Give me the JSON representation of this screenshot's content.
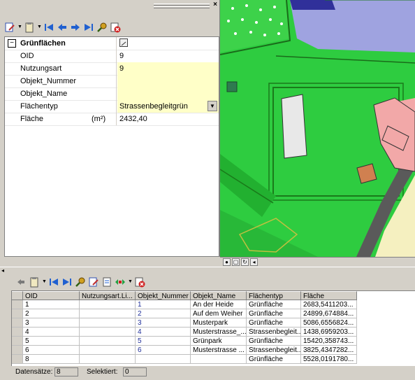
{
  "attributes": {
    "group": "Grünflächen",
    "rows": [
      {
        "label": "OID",
        "value": "9"
      },
      {
        "label": "Nutzungsart",
        "value": "9"
      },
      {
        "label": "Objekt_Nummer",
        "value": ""
      },
      {
        "label": "Objekt_Name",
        "value": ""
      },
      {
        "label": "Flächentyp",
        "value": "Strassenbegleitgrün"
      },
      {
        "label": "Fläche",
        "unit": "(m²)",
        "value": "2432,40"
      }
    ]
  },
  "table": {
    "headers": [
      "OID",
      "Nutzungsart.Li...",
      "Objekt_Nummer",
      "Objekt_Name",
      "Flächentyp",
      "Fläche"
    ],
    "rows": [
      [
        "1",
        "",
        "1",
        "An der Heide",
        "Grünfläche",
        "2683,5411203..."
      ],
      [
        "2",
        "",
        "2",
        "Auf dem Weiher",
        "Grünfläche",
        "24899,674884..."
      ],
      [
        "3",
        "",
        "3",
        "Musterpark",
        "Grünfläche",
        "5086,6556824..."
      ],
      [
        "4",
        "",
        "4",
        "Musterstrasse_...",
        "Strassenbegleit...",
        "1438,6959203..."
      ],
      [
        "5",
        "",
        "5",
        "Grünpark",
        "Grünfläche",
        "15420,358743..."
      ],
      [
        "6",
        "",
        "6",
        "Musterstrasse ...",
        "Strassenbegleit...",
        "3825,4347282..."
      ],
      [
        "8",
        "",
        "",
        "",
        "Grünfläche",
        "5528,0191780..."
      ]
    ]
  },
  "status": {
    "records_label": "Datensätze:",
    "records_value": "8",
    "selected_label": "Selektiert:",
    "selected_value": "0"
  },
  "icons": {
    "close": "×",
    "dropdown": "▼",
    "expand": "−",
    "grip": "◂"
  },
  "colors": {
    "map_green": "#2ecc40",
    "field_yellow": "#ffffc8",
    "link_blue": "#1f2f9a"
  }
}
